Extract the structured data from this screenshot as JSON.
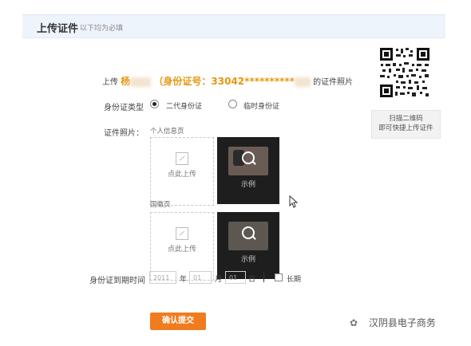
{
  "header": {
    "title": "上传证件",
    "subtitle": "以下均为必填"
  },
  "upload_intro": {
    "prefix": "上传",
    "name": "杨",
    "id_label": "（身份证号：",
    "id_number": "33042**********",
    "suffix": "的证件照片"
  },
  "id_type": {
    "label": "身份证类型",
    "options": [
      {
        "label": "二代身份证",
        "checked": true
      },
      {
        "label": "临时身份证",
        "checked": false
      }
    ]
  },
  "photos": {
    "label": "证件照片：",
    "front_label": "个人信息页",
    "back_label": "国徽页",
    "upload_text": "点此上传",
    "example_text": "示例"
  },
  "qr": {
    "line1": "扫描二维码",
    "line2": "即可快捷上传证件"
  },
  "expiry": {
    "label": "身份证到期时间",
    "year_placeholder": "2011",
    "year_unit": "年",
    "month_placeholder": "01",
    "month_unit": "月",
    "day_placeholder": "01",
    "day_unit": "日",
    "long_term": "长期"
  },
  "submit_label": "确认提交",
  "watermark": "汉阴县电子商务"
}
